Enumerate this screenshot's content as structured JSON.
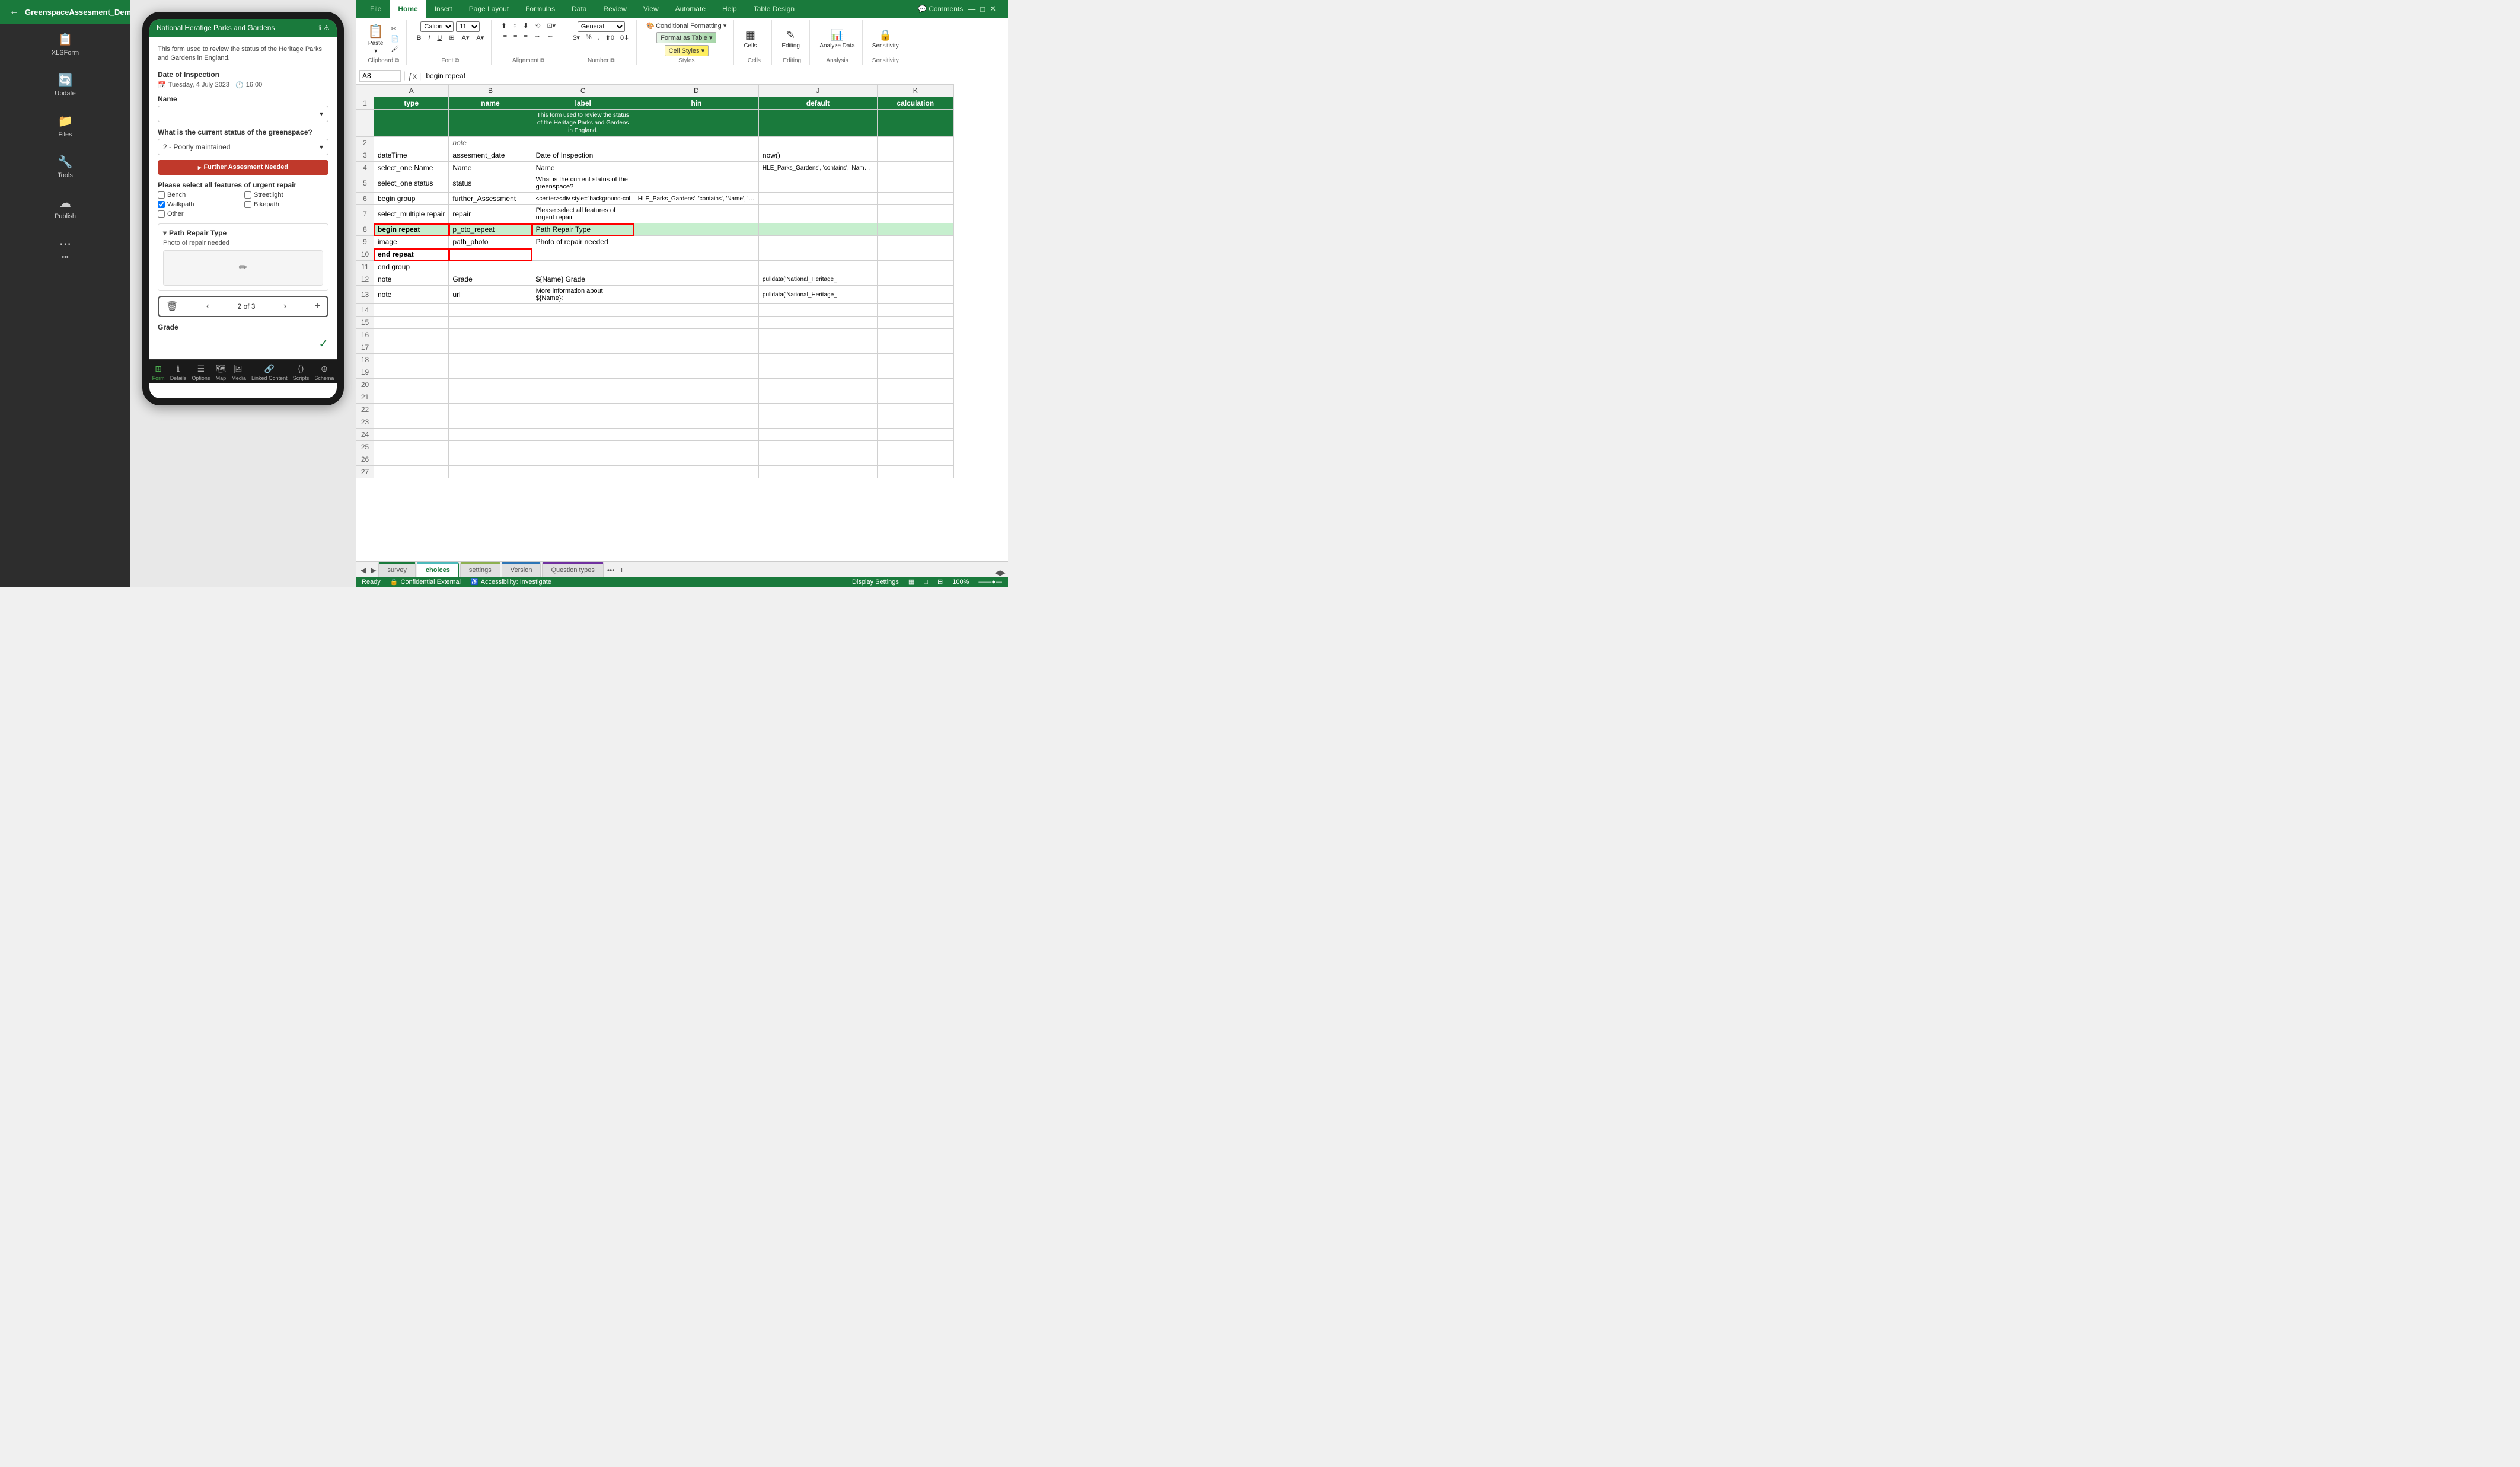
{
  "app": {
    "title": "GreenspaceAssesment_Demo"
  },
  "left_nav": {
    "back_label": "←",
    "menu_label": "☰",
    "items": [
      {
        "label": "XLSForm",
        "icon": "📋",
        "id": "xlsform"
      },
      {
        "label": "Update",
        "icon": "🔄",
        "id": "update"
      },
      {
        "label": "Files",
        "icon": "📁",
        "id": "files"
      },
      {
        "label": "Tools",
        "icon": "🔧",
        "id": "tools"
      },
      {
        "label": "Publish",
        "icon": "☁",
        "id": "publish"
      },
      {
        "label": "•••",
        "icon": "⋯",
        "id": "more"
      }
    ]
  },
  "phone": {
    "top_bar_title": "National Heratige Parks and Gardens",
    "form_description": "This form used to review the status of the Heritage Parks and Gardens in England.",
    "date_label": "Date of Inspection",
    "date_value": "Tuesday, 4 July 2023",
    "time_value": "16:00",
    "name_label": "Name",
    "greenspace_label": "What is the current status of the greenspace?",
    "greenspace_value": "2 - Poorly maintained",
    "further_assessment_banner": "Further Assesment Needed",
    "urgent_repair_label": "Please select all features of urgent repair",
    "checkboxes": [
      {
        "label": "Bench",
        "checked": false
      },
      {
        "label": "Streetlight",
        "checked": false
      },
      {
        "label": "Walkpath",
        "checked": true
      },
      {
        "label": "Bikepath",
        "checked": false
      },
      {
        "label": "Other",
        "checked": false
      }
    ],
    "path_repair_title": "Path Repair Type",
    "photo_label": "Photo of repair needed",
    "repeat_of": "2 of 3",
    "grade_label": "Grade",
    "nav_items": [
      {
        "label": "Form",
        "icon": "⊞",
        "active": true
      },
      {
        "label": "Details",
        "icon": "ℹ",
        "active": false
      },
      {
        "label": "Options",
        "icon": "☰",
        "active": false
      },
      {
        "label": "Map",
        "icon": "🗺",
        "active": false
      },
      {
        "label": "Media",
        "icon": "🖼",
        "active": false
      },
      {
        "label": "Linked Content",
        "icon": "🔗",
        "active": false
      },
      {
        "label": "Scripts",
        "icon": "⟨⟩",
        "active": false
      },
      {
        "label": "Schema",
        "icon": "⊕",
        "active": false
      }
    ]
  },
  "ribbon": {
    "tabs": [
      "File",
      "Home",
      "Insert",
      "Page Layout",
      "Formulas",
      "Data",
      "Review",
      "View",
      "Automate",
      "Help",
      "Table Design"
    ],
    "active_tab": "Home",
    "comments_label": "Comments",
    "groups": {
      "clipboard": {
        "label": "Clipboard",
        "paste_label": "Paste"
      },
      "font": {
        "label": "Font",
        "font_name": "Calibri",
        "font_size": "11"
      },
      "alignment": {
        "label": "Alignment"
      },
      "number": {
        "label": "Number",
        "format": "General"
      },
      "styles": {
        "label": "Styles",
        "conditional_formatting": "Conditional Formatting ▾",
        "format_as_table": "Format as Table ▾",
        "cell_styles": "Cell Styles ▾"
      },
      "cells": {
        "label": "Cells",
        "btn": "Cells"
      },
      "editing": {
        "label": "Editing",
        "btn": "Editing"
      },
      "analyze_data": {
        "label": "Analysis",
        "btn": "Analyze Data"
      },
      "sensitivity": {
        "label": "Sensitivity"
      }
    }
  },
  "formula_bar": {
    "cell_ref": "A8",
    "formula": "begin repeat"
  },
  "spreadsheet": {
    "columns": [
      "",
      "A",
      "B",
      "C",
      "D",
      "J",
      "K"
    ],
    "col_headers": [
      "type",
      "name",
      "label",
      "hin",
      "default",
      "calculation"
    ],
    "rows": [
      {
        "num": 1,
        "cells": [
          "type",
          "name",
          "label",
          "",
          "default",
          "calculation"
        ],
        "class": "header-row"
      },
      {
        "num": 2,
        "cells": [
          "",
          "note",
          "",
          "",
          "",
          ""
        ],
        "class": "note-row"
      },
      {
        "num": 3,
        "cells": [
          "dateTime",
          "assesment_date",
          "Date of Inspection",
          "",
          "now()",
          ""
        ],
        "class": ""
      },
      {
        "num": 4,
        "cells": [
          "select_one Name",
          "Name",
          "Name",
          "",
          "HLE_Parks_Gardens', 'contains', 'Name', '${Name}}",
          ""
        ],
        "class": ""
      },
      {
        "num": 5,
        "cells": [
          "select_one status",
          "status",
          "What is the current status of the greenspace?",
          "",
          "",
          ""
        ],
        "class": ""
      },
      {
        "num": 6,
        "cells": [
          "begin group",
          "further_Assessment",
          "<center><div style=\"background-col",
          "HLE_Parks_Gardens', 'contains', 'Name', '${Name}')",
          ""
        ],
        "class": ""
      },
      {
        "num": 7,
        "cells": [
          "select_multiple repair",
          "repair",
          "Please select all features of urgent repair",
          "",
          "",
          ""
        ],
        "class": ""
      },
      {
        "num": 8,
        "cells": [
          "begin repeat",
          "p_oto_repeat",
          "Path Repair Type",
          "",
          "",
          ""
        ],
        "class": "repeat-row red-row"
      },
      {
        "num": 9,
        "cells": [
          "image",
          "path_photo",
          "Photo of repair needed",
          "",
          "",
          ""
        ],
        "class": ""
      },
      {
        "num": 10,
        "cells": [
          "end repeat",
          "",
          "",
          "",
          "",
          ""
        ],
        "class": "repeat-row red-row"
      },
      {
        "num": 11,
        "cells": [
          "end group",
          "",
          "",
          "",
          "",
          ""
        ],
        "class": ""
      },
      {
        "num": 12,
        "cells": [
          "note",
          "Grade",
          "${Name} Grade",
          "",
          "pulldata('National_Heritage_",
          ""
        ],
        "class": ""
      },
      {
        "num": 13,
        "cells": [
          "note",
          "url",
          "More information about ${Name}:",
          "",
          "pulldata('National_Heritage_",
          ""
        ],
        "class": ""
      },
      {
        "num": 14,
        "cells": [
          "",
          "",
          "",
          "",
          "",
          ""
        ],
        "class": ""
      },
      {
        "num": 15,
        "cells": [
          "",
          "",
          "",
          "",
          "",
          ""
        ],
        "class": ""
      },
      {
        "num": 16,
        "cells": [
          "",
          "",
          "",
          "",
          "",
          ""
        ],
        "class": ""
      },
      {
        "num": 17,
        "cells": [
          "",
          "",
          "",
          "",
          "",
          ""
        ],
        "class": ""
      },
      {
        "num": 18,
        "cells": [
          "",
          "",
          "",
          "",
          "",
          ""
        ],
        "class": ""
      },
      {
        "num": 19,
        "cells": [
          "",
          "",
          "",
          "",
          "",
          ""
        ],
        "class": ""
      },
      {
        "num": 20,
        "cells": [
          "",
          "",
          "",
          "",
          "",
          ""
        ],
        "class": ""
      },
      {
        "num": 21,
        "cells": [
          "",
          "",
          "",
          "",
          "",
          ""
        ],
        "class": ""
      },
      {
        "num": 22,
        "cells": [
          "",
          "",
          "",
          "",
          "",
          ""
        ],
        "class": ""
      },
      {
        "num": 23,
        "cells": [
          "",
          "",
          "",
          "",
          "",
          ""
        ],
        "class": ""
      },
      {
        "num": 24,
        "cells": [
          "",
          "",
          "",
          "",
          "",
          ""
        ],
        "class": ""
      },
      {
        "num": 25,
        "cells": [
          "",
          "",
          "",
          "",
          "",
          ""
        ],
        "class": ""
      },
      {
        "num": 26,
        "cells": [
          "",
          "",
          "",
          "",
          "",
          ""
        ],
        "class": ""
      },
      {
        "num": 27,
        "cells": [
          "",
          "",
          "",
          "",
          "",
          ""
        ],
        "class": ""
      }
    ],
    "header_subtitle": "This form used to review the status of the Heritage Parks and Gardens in England."
  },
  "sheet_tabs": [
    {
      "label": "survey",
      "active": false,
      "color": "green"
    },
    {
      "label": "choices",
      "active": true,
      "color": "teal"
    },
    {
      "label": "settings",
      "active": false,
      "color": "olive"
    },
    {
      "label": "Version",
      "active": false,
      "color": "blue"
    },
    {
      "label": "Question types",
      "active": false,
      "color": "purple"
    }
  ],
  "status_bar": {
    "ready_label": "Ready",
    "confidential_label": "Confidential External",
    "accessibility_label": "Accessibility: Investigate",
    "display_settings_label": "Display Settings",
    "zoom_label": "100%"
  }
}
